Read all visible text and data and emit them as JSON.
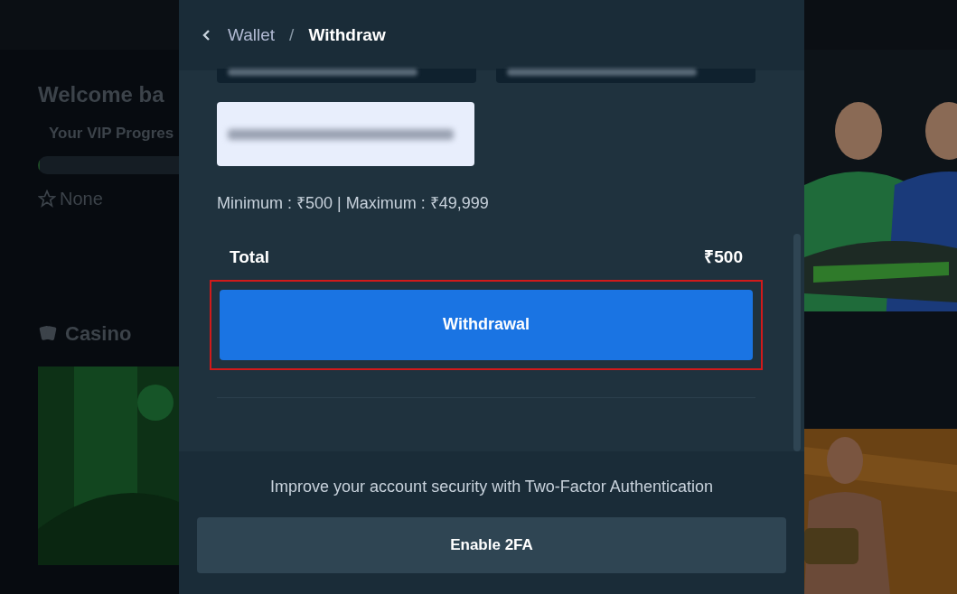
{
  "background": {
    "greeting": "Welcome ba",
    "vip_label": "Your VIP Progres",
    "vip_progress": {
      "level": 0.01
    },
    "vip_rank": "None",
    "section": "Casino"
  },
  "modal": {
    "breadcrumb": [
      {
        "label": "Wallet",
        "current": false
      },
      {
        "label": "Withdraw",
        "current": true
      }
    ],
    "breadcrumb_separator": "/",
    "top_fields": [
      {
        "kind": "blurred"
      },
      {
        "kind": "blurred"
      }
    ],
    "branch_field": {
      "kind": "blurred"
    },
    "limits": "Minimum : ₹500 | Maximum : ₹49,999",
    "total": {
      "label": "Total",
      "value": "₹500"
    },
    "submit": {
      "label": "Withdrawal",
      "highlighted": true
    },
    "security_note": "Improve your account security with Two-Factor Authentication",
    "enable_2fa": "Enable 2FA"
  }
}
